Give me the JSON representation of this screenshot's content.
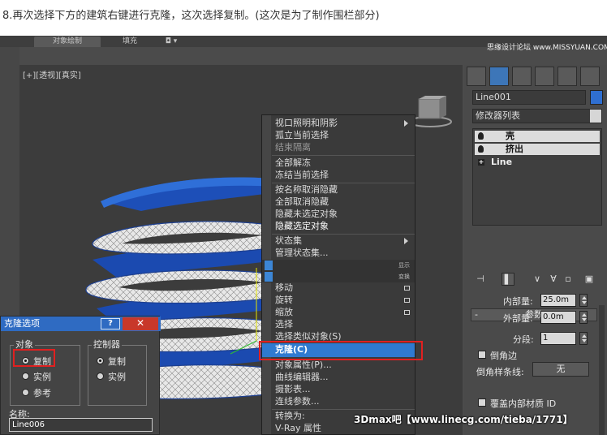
{
  "caption": "8.再次选择下方的建筑右键进行克隆，这次选择复制。(这次是为了制作围栏部分)",
  "tabs": [
    "对象绘制",
    "填充",
    "◘ ▾"
  ],
  "viewport": {
    "label": "[+][透视][真实]"
  },
  "context_menu": {
    "items": [
      "视口照明和阴影",
      "孤立当前选择",
      "结束隔离",
      "全部解冻",
      "冻结当前选择",
      "按名称取消隐藏",
      "全部取消隐藏",
      "隐藏未选定对象",
      "隐藏选定对象",
      "状态集",
      "管理状态集...",
      "移动",
      "旋转",
      "缩放",
      "选择",
      "选择类似对象(S)",
      "克隆(C)",
      "对象属性(P)...",
      "曲线编辑器...",
      "摄影表...",
      "连线参数...",
      "转换为:",
      "V-Ray 属性"
    ],
    "quad_labels": [
      "显示",
      "变换"
    ],
    "highlighted": "克隆(C)"
  },
  "command_panel": {
    "object_name": "Line001",
    "object_color": "#2f6fd1",
    "modifier_list": "修改器列表",
    "stack": [
      "壳",
      "挤出",
      "Line"
    ],
    "rollout_title": "参数",
    "inner_label": "内部量:",
    "inner_value": "25.0m",
    "outer_label": "外部量:",
    "outer_value": "0.0m",
    "segments_label": "分段:",
    "segments_value": "1",
    "bevel_edges": "倒角边",
    "bevel_spline_label": "倒角样条线:",
    "bevel_spline_value": "无",
    "override_label": "覆盖内部材质 ID"
  },
  "clone_dialog": {
    "title": "克隆选项",
    "help": "?",
    "close": "✕",
    "object_group": "对象",
    "object_options": [
      "复制",
      "实例",
      "参考"
    ],
    "controller_group": "控制器",
    "controller_options": [
      "复制",
      "实例"
    ],
    "name_label": "名称:",
    "name_value": "Line006"
  },
  "watermarks": {
    "top": "思缘设计论坛 www.MISSYUAN.COM",
    "bottom": "3Dmax吧【www.linecg.com/tieba/1771】"
  },
  "colors": {
    "accent": "#2f7ad0",
    "highlight_box": "#e02020",
    "dialog_title": "#2f6bc2"
  }
}
